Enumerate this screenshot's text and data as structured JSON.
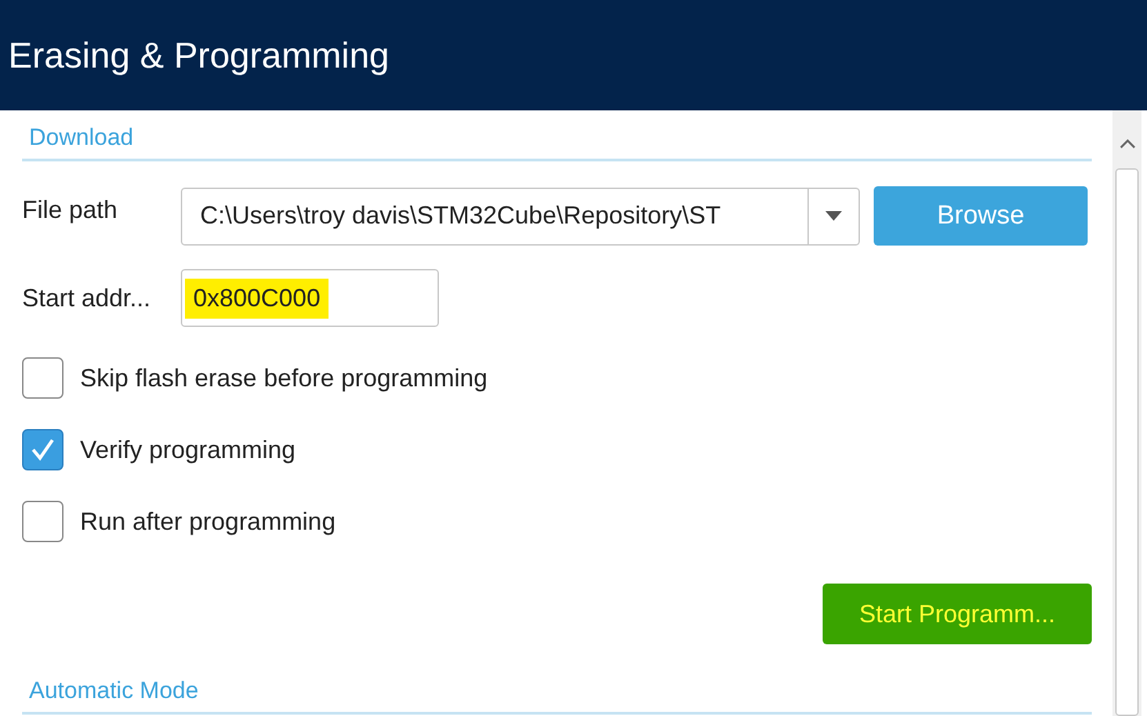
{
  "window": {
    "title": "Erasing & Programming"
  },
  "download": {
    "heading": "Download",
    "file_path": {
      "label": "File path",
      "value": "C:\\Users\\troy davis\\STM32Cube\\Repository\\ST",
      "button": "Browse"
    },
    "start_address": {
      "label": "Start addr...",
      "value": "0x800C000",
      "highlighted": true
    },
    "options": [
      {
        "label": "Skip flash erase before programming",
        "checked": false
      },
      {
        "label": "Verify programming",
        "checked": true
      },
      {
        "label": "Run after programming",
        "checked": false
      }
    ],
    "start_button": {
      "label": "Start Programm...",
      "highlighted": true
    }
  },
  "automatic_mode": {
    "heading": "Automatic Mode"
  }
}
